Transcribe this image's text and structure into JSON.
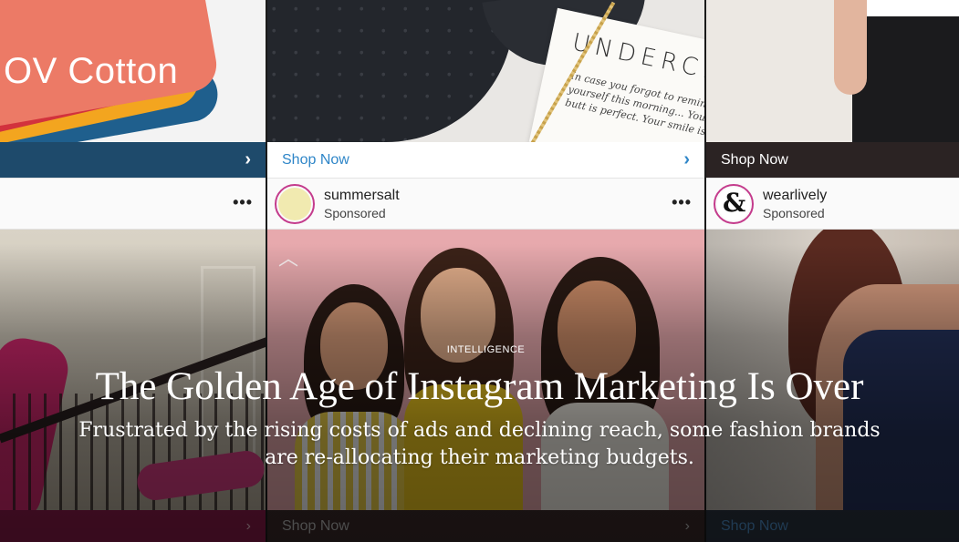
{
  "hero": {
    "left_post": {
      "image_text": "OV Cotton",
      "cta_icon": "chevron-right-icon",
      "bottom_cta_icon": "chevron-right-icon"
    },
    "middle_post": {
      "card_brand": "UNDERCLU",
      "card_note": "In case you forgot to remind yourself this morning... Your butt is perfect. Your smile is...",
      "cta_label": "Shop Now",
      "cta_icon": "chevron-right-icon",
      "account_name": "summersalt",
      "account_meta": "Sponsored",
      "more_label": "•••",
      "bottom_cta_label": "Shop Now",
      "bottom_cta_icon": "chevron-right-icon",
      "collapse_icon": "chevron-up-icon"
    },
    "right_post": {
      "cta_label": "Shop Now",
      "account_name": "wearlively",
      "account_meta": "Sponsored",
      "avatar_glyph": "&",
      "bottom_cta_label": "Shop Now"
    },
    "left_more_label": "•••"
  },
  "article": {
    "kicker": "INTELLIGENCE",
    "headline": "The Golden Age of Instagram Marketing Is Over",
    "dek": "Frustrated by the rising costs of ads and declining reach, some fashion brands are re-allocating their marketing budgets."
  },
  "colors": {
    "instagram_link_blue": "#2f86c8",
    "avatar_ring": "#c43b8c"
  }
}
